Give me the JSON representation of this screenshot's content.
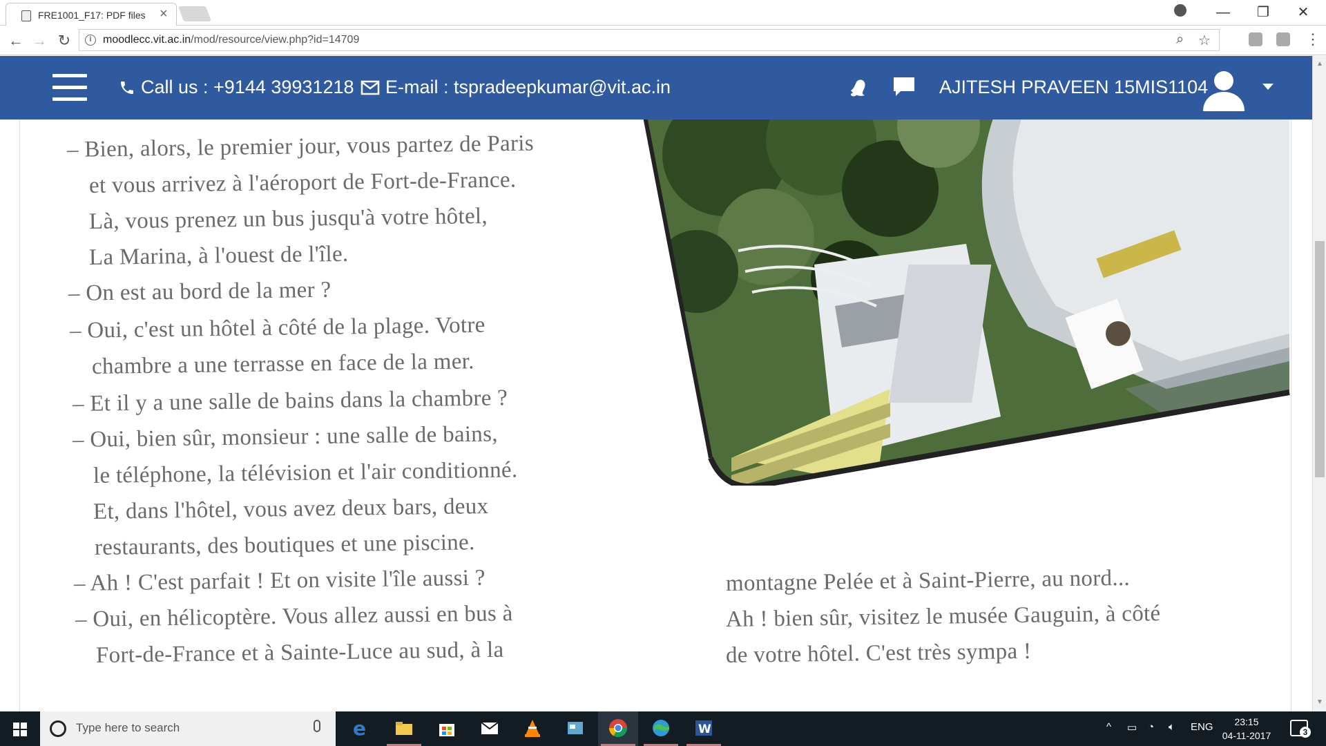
{
  "browser": {
    "tab_title": "FRE1001_F17: PDF files",
    "tab_close": "×",
    "url_host": "moodlecc.vit.ac.in",
    "url_path": "/mod/resource/view.php?id=14709",
    "win_min": "—",
    "win_max": "❐",
    "win_close": "✕",
    "back": "←",
    "forward": "→",
    "reload": "↻",
    "zoom_icon": "⌕",
    "star_icon": "☆",
    "menu_icon": "⋮"
  },
  "header": {
    "call_label": "Call us : +9144 39931218",
    "email_label": "E-mail : tspradeepkumar@vit.ac.in",
    "username": "AJITESH PRAVEEN 15MIS1104",
    "accent_color": "#2f5a9f"
  },
  "document": {
    "left_column": [
      "– Bien, alors, le premier jour, vous partez de Paris",
      "et vous arrivez à l'aéroport de Fort-de-France.",
      "Là, vous prenez un bus jusqu'à votre hôtel,",
      "La Marina, à l'ouest de l'île.",
      "– On est au bord de la mer ?",
      "– Oui, c'est un hôtel à côté de la plage. Votre",
      "chambre a une terrasse en face de la mer.",
      "– Et il y a une salle de bains dans la chambre ?",
      "– Oui, bien sûr, monsieur : une salle de bains,",
      "le téléphone, la télévision et l'air conditionné.",
      "Et, dans l'hôtel, vous avez deux bars, deux",
      "restaurants, des boutiques et une piscine.",
      "– Ah ! C'est parfait ! Et on visite l'île aussi ?",
      "– Oui, en hélicoptère. Vous allez aussi en bus à",
      "Fort-de-France et à Sainte-Luce au sud, à la"
    ],
    "right_column": [
      "montagne Pelée et à Saint-Pierre, au nord...",
      "Ah ! bien sûr, visitez le musée Gauguin, à côté",
      "de votre hôtel. C'est très sympa !"
    ]
  },
  "taskbar": {
    "search_placeholder": "Type here to search",
    "language": "ENG",
    "time": "23:15",
    "date": "04-11-2017",
    "notification_count": "3"
  }
}
